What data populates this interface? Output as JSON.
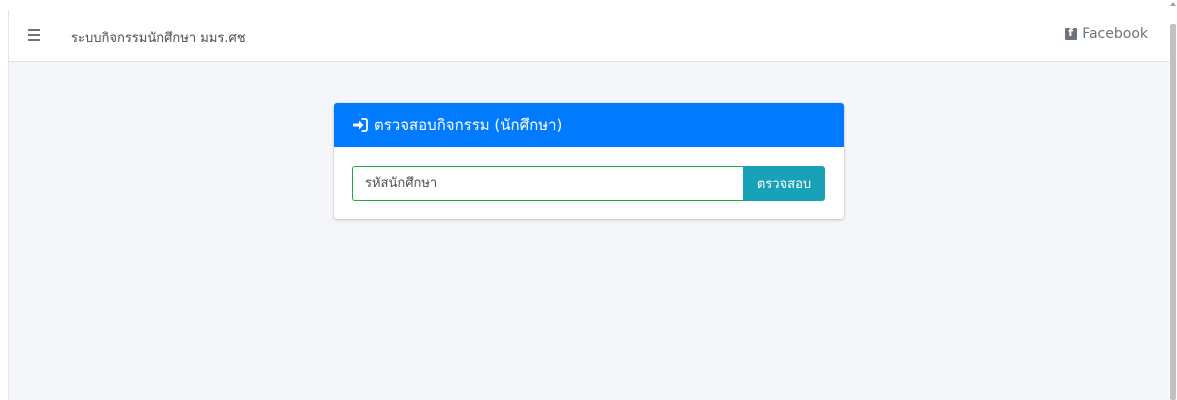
{
  "navbar": {
    "menu_icon": "hamburger-icon",
    "title": "ระบบกิจกรรมนักศึกษา มมร.ศช",
    "facebook_icon": "facebook-square-icon",
    "facebook_label": "Facebook"
  },
  "card": {
    "header_icon": "sign-in-icon",
    "title": "ตรวจสอบกิจกรรม (นักศึกษา)",
    "input": {
      "placeholder": "รหัสนักศึกษา",
      "value": ""
    },
    "button_label": "ตรวจสอบ"
  },
  "colors": {
    "primary": "#007bff",
    "info": "#17a2b8",
    "success_border": "#28a745",
    "background": "#f4f6f9"
  }
}
